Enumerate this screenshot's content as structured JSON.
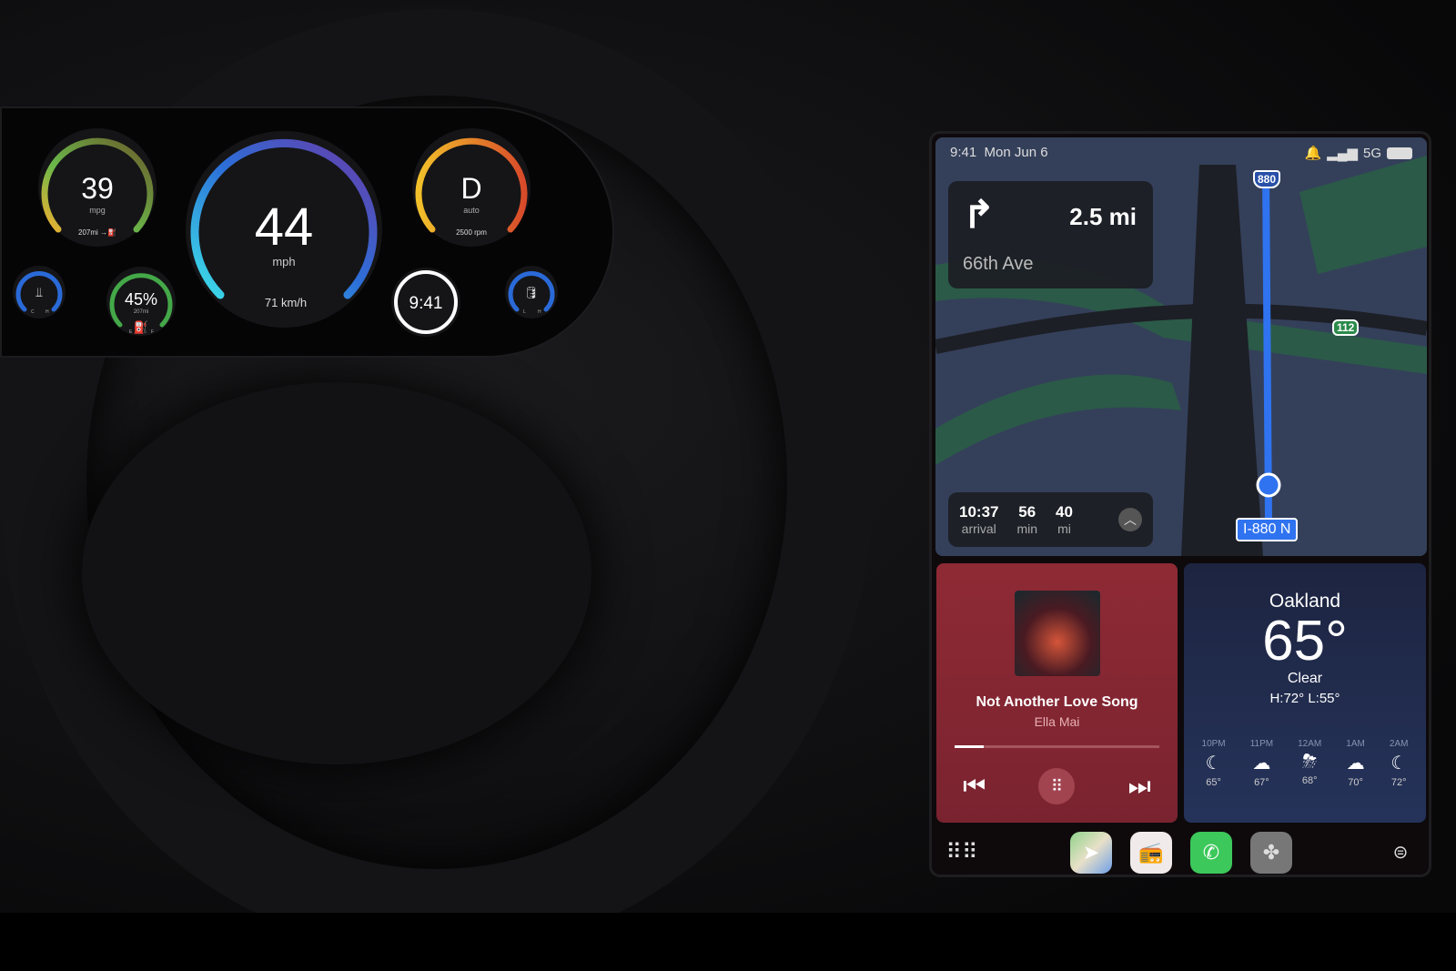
{
  "cluster": {
    "mpg": {
      "value": "39",
      "unit": "mpg",
      "range": "207mi →⛽"
    },
    "speed": {
      "value": "44",
      "unit": "mph",
      "metric": "71 km/h",
      "fraction": 0.44
    },
    "gear": {
      "value": "D",
      "mode": "auto",
      "rpm": "2500 rpm"
    },
    "coolant": {
      "low": "C",
      "high": "H"
    },
    "fuel": {
      "value": "45%",
      "range": "207mi",
      "low": "E",
      "high": "F",
      "fraction": 0.45
    },
    "clock": "9:41",
    "oil": {
      "low": "L",
      "high": "H"
    }
  },
  "carplay": {
    "status": {
      "time": "9:41",
      "date": "Mon Jun 6",
      "network": "5G"
    },
    "nav": {
      "distance": "2.5 mi",
      "street": "66th Ave",
      "arrival": "10:37",
      "arrival_label": "arrival",
      "minutes": "56",
      "minutes_label": "min",
      "miles": "40",
      "miles_label": "mi",
      "highway": "I-880 N",
      "shield_880": "880",
      "shield_112": "112"
    },
    "music": {
      "title": "Not Another Love Song",
      "artist": "Ella Mai",
      "progress": 0.14
    },
    "weather": {
      "city": "Oakland",
      "temp": "65°",
      "condition": "Clear",
      "hilo": "H:72°  L:55°",
      "hours": [
        {
          "time": "10PM",
          "icon": "☾",
          "temp": "65°"
        },
        {
          "time": "11PM",
          "icon": "☁",
          "temp": "67°"
        },
        {
          "time": "12AM",
          "icon": "⛈",
          "temp": "68°"
        },
        {
          "time": "1AM",
          "icon": "☁",
          "temp": "70°"
        },
        {
          "time": "2AM",
          "icon": "☾",
          "temp": "72°"
        }
      ]
    },
    "dock": [
      "app-grid",
      "maps",
      "podcasts-radio",
      "phone",
      "fan-climate",
      "dashboard-toggle"
    ]
  }
}
